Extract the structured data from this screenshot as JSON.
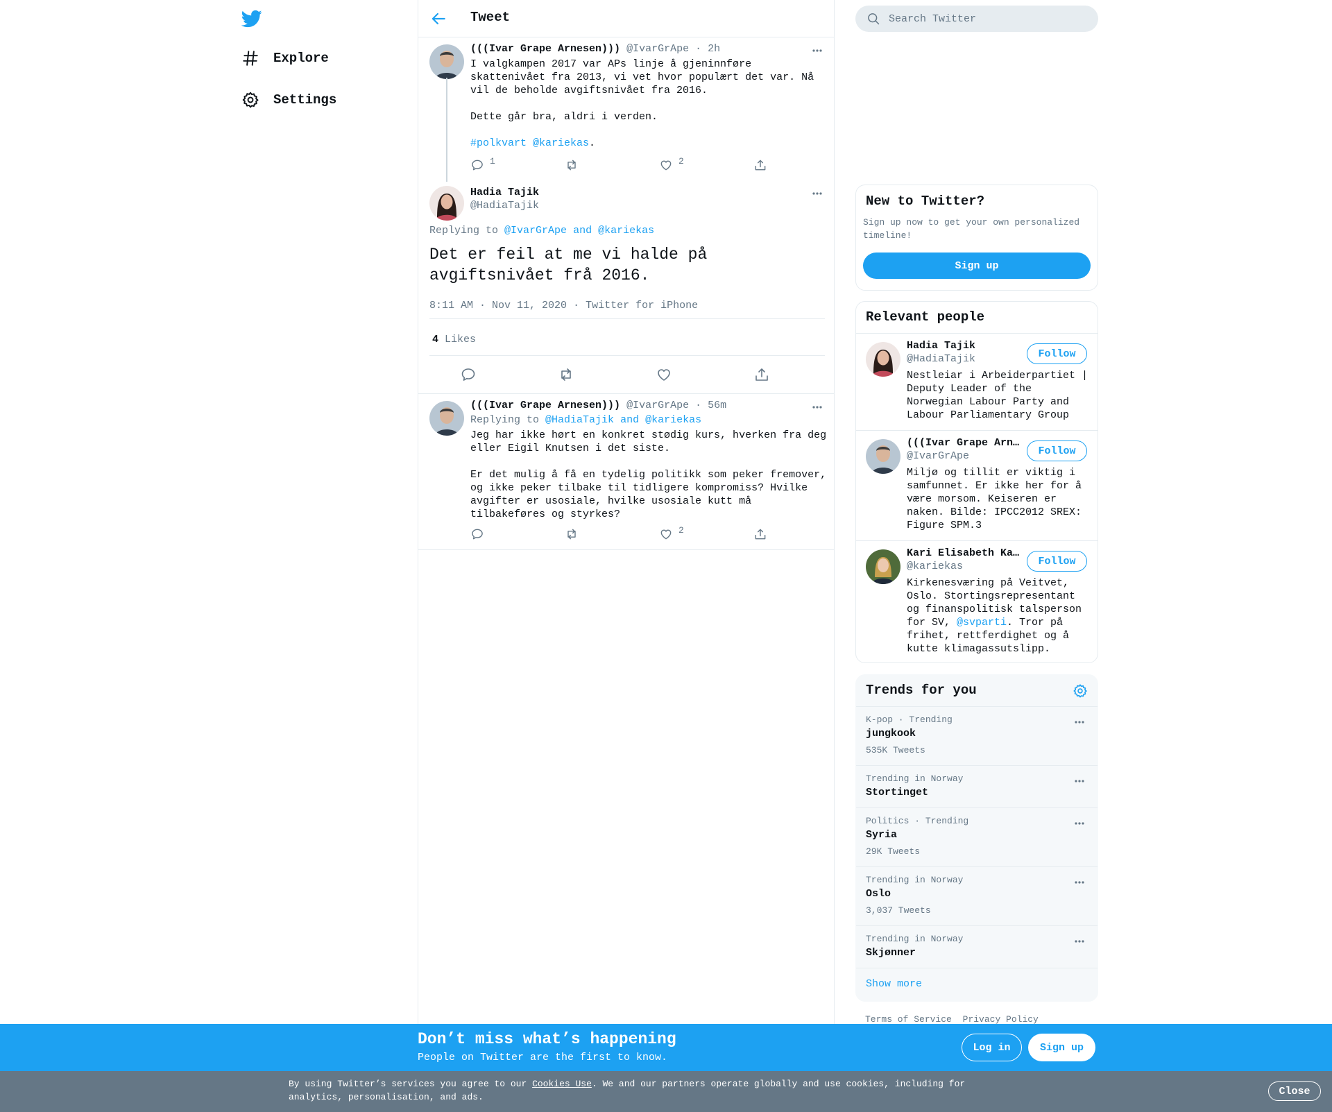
{
  "nav": {
    "explore_label": "Explore",
    "settings_label": "Settings"
  },
  "header": {
    "title": "Tweet"
  },
  "tweets": [
    {
      "name": "(((Ivar Grape Arnesen)))",
      "handle": "@IvarGrApe",
      "time": "· 2h",
      "text_before": "I valgkampen 2017 var APs linje å gjeninnføre skattenivået fra 2013, vi vet hvor populært det var. Nå vil de beholde avgiftsnivået fra 2016.\n\nDette går bra, aldri i verden.\n\n",
      "hashtag": "#polkvart",
      "mention": "@kariekas",
      "text_after": ".",
      "reply_count": "1",
      "like_count": "2"
    },
    {
      "name": "Hadia Tajik",
      "handle": "@HadiaTajik",
      "replying_prefix": "Replying to",
      "replying_to": "@IvarGrApe and @kariekas",
      "text": "Det er feil at me vi halde på avgiftsnivået frå 2016.",
      "timestamp": "8:11 AM · Nov 11, 2020",
      "source": "· Twitter for iPhone",
      "likes_count": "4",
      "likes_label": "Likes"
    },
    {
      "name": "(((Ivar Grape Arnesen)))",
      "handle": "@IvarGrApe",
      "time": "· 56m",
      "replying_prefix": "Replying to",
      "replying_to": "@HadiaTajik and @kariekas",
      "text": "Jeg har ikke hørt en konkret stødig kurs, hverken fra deg eller Eigil Knutsen i det siste.\n\nEr det mulig å få en tydelig politikk som peker fremover, og ikke peker tilbake til tidligere kompromiss? Hvilke avgifter er usosiale, hvilke usosiale kutt må tilbakeføres og styrkes?",
      "like_count": "2"
    }
  ],
  "search": {
    "placeholder": "Search Twitter"
  },
  "new_to_twitter": {
    "title": "New to Twitter?",
    "subtitle": "Sign up now to get your own personalized timeline!",
    "button": "Sign up"
  },
  "relevant_people": {
    "title": "Relevant people",
    "follow_label": "Follow",
    "people": [
      {
        "name": "Hadia Tajik",
        "handle": "@HadiaTajik",
        "bio": "Nestleiar i Arbeiderpartiet | Deputy Leader of the Norwegian Labour Party and Labour Parliamentary Group"
      },
      {
        "name": "(((Ivar Grape Arnesen)))",
        "handle": "@IvarGrApe",
        "bio": "Miljø og tillit er viktig i samfunnet. Er ikke her for å være morsom. Keiseren er naken. Bilde: IPCC2012 SREX: Figure SPM.3"
      },
      {
        "name": "Kari Elisabeth Kaski",
        "handle": "@kariekas",
        "bio_before": "Kirkenesværing på Veitvet, Oslo. Stortingsrepresentant og finanspolitisk talsperson for SV, ",
        "bio_link": "@svparti",
        "bio_after": ". Tror på frihet, rettferdighet og å kutte klimagassutslipp."
      }
    ]
  },
  "trends": {
    "title": "Trends for you",
    "items": [
      {
        "category": "K-pop · Trending",
        "name": "jungkook",
        "count": "535K Tweets"
      },
      {
        "category": "Trending in Norway",
        "name": "Stortinget",
        "count": ""
      },
      {
        "category": "Politics · Trending",
        "name": "Syria",
        "count": "29K Tweets"
      },
      {
        "category": "Trending in Norway",
        "name": "Oslo",
        "count": "3,037 Tweets"
      },
      {
        "category": "Trending in Norway",
        "name": "Skjønner",
        "count": ""
      }
    ],
    "show_more": "Show more"
  },
  "footer": {
    "terms": "Terms of Service",
    "privacy": "Privacy Policy"
  },
  "promo": {
    "title": "Don’t miss what’s happening",
    "subtitle": "People on Twitter are the first to know.",
    "login": "Log in",
    "signup": "Sign up"
  },
  "cookie": {
    "before": "By using Twitter’s services you agree to our ",
    "link": "Cookies Use",
    "after": ". We and our partners operate globally and use cookies, including for analytics, personalisation, and ads.",
    "close": "Close"
  },
  "colors": {
    "accent": "#1da1f2",
    "secondary_text": "#657786",
    "border": "#e6ecf0",
    "cookie_bar": "#657786"
  }
}
